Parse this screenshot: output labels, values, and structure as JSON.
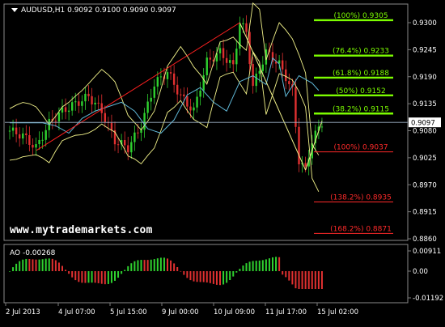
{
  "header": {
    "text": "AUDUSD,H1  0.9092 0.9100 0.9090 0.9097"
  },
  "watermark": "www.mytrademarkets.com",
  "ao_label": "AO -0.00268",
  "price_axis": {
    "ticks": [
      "0.9300",
      "0.9245",
      "0.9190",
      "0.9135",
      "0.9080",
      "0.9025",
      "0.8970",
      "0.8915",
      "0.8860"
    ],
    "current": "0.9097"
  },
  "ao_axis": {
    "ticks": [
      "0.00911",
      "0.00",
      "-0.01192"
    ]
  },
  "time_axis": {
    "ticks": [
      "2 Jul 2013",
      "4 Jul 07:00",
      "5 Jul 15:00",
      "9 Jul 00:00",
      "10 Jul 09:00",
      "11 Jul 17:00",
      "15 Jul 02:00"
    ]
  },
  "fib_levels": [
    {
      "label": "(100%) 0.9305",
      "color": "#7cfc00"
    },
    {
      "label": "(76.4%) 0.9233",
      "color": "#7cfc00"
    },
    {
      "label": "(61.8%) 0.9188",
      "color": "#7cfc00"
    },
    {
      "label": "(50%) 0.9152",
      "color": "#7cfc00"
    },
    {
      "label": "(38.2%) 0.9115",
      "color": "#7cfc00"
    },
    {
      "label": "(100%) 0.9037",
      "color": "#ff2a2a"
    },
    {
      "label": "(138.2%) 0.8935",
      "color": "#ff2a2a"
    },
    {
      "label": "(168.2%) 0.8871",
      "color": "#ff2a2a"
    }
  ],
  "colors": {
    "bull": "#2fd12f",
    "bear": "#e03030",
    "grid": "#7a7a7a",
    "text": "#ffffff",
    "envelope": "#f2f28a",
    "ma": "#5fb7d6",
    "trend": "#ff2020"
  }
}
